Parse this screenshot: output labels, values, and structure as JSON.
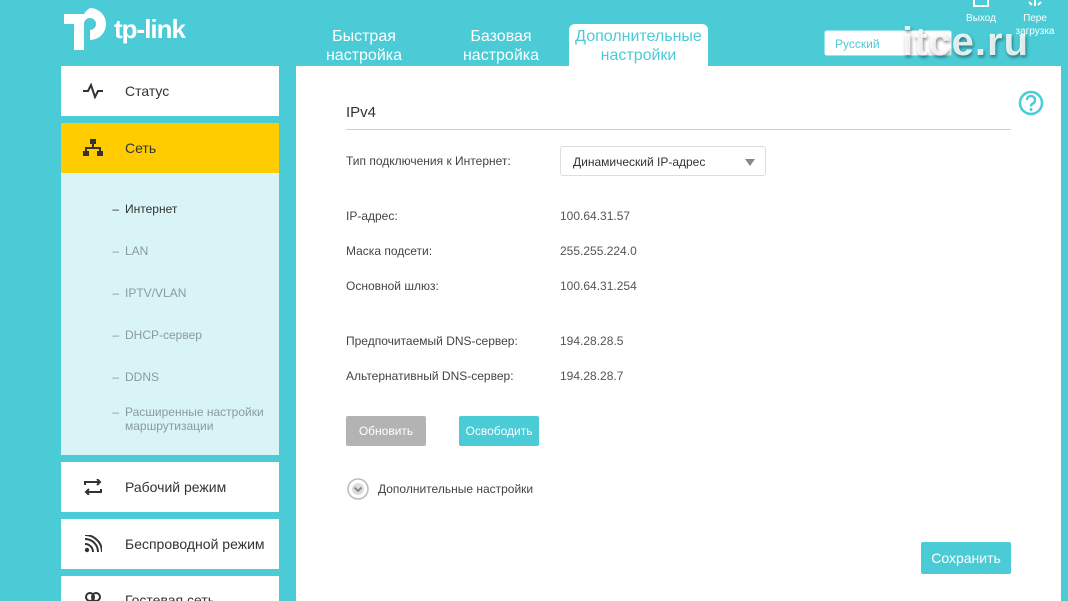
{
  "header": {
    "logo_text": "tp-link",
    "tabs": [
      {
        "label": "Быстрая настройка"
      },
      {
        "label": "Базовая настройка"
      },
      {
        "label": "Дополнительные настройки"
      }
    ],
    "language": "Русский",
    "logout_label": "Выход",
    "reboot_label": "Пере загрузка",
    "watermark": "itce.ru"
  },
  "sidebar": {
    "items": [
      {
        "label": "Статус",
        "icon": "pulse-icon"
      },
      {
        "label": "Сеть",
        "icon": "network-icon"
      },
      {
        "label": "Рабочий режим",
        "icon": "mode-switch-icon"
      },
      {
        "label": "Беспроводной режим",
        "icon": "wireless-icon"
      },
      {
        "label": "Гостевая сеть",
        "icon": "guest-network-icon"
      }
    ],
    "sub_items": [
      {
        "label": "Интернет"
      },
      {
        "label": "LAN"
      },
      {
        "label": "IPTV/VLAN"
      },
      {
        "label": "DHCP-сервер"
      },
      {
        "label": "DDNS"
      },
      {
        "label": "Расширенные настройки маршрутизации"
      }
    ]
  },
  "main": {
    "title": "IPv4",
    "connection_type_label": "Тип подключения к Интернет:",
    "connection_type_value": "Динамический IP-адрес",
    "fields": [
      {
        "label": "IP-адрес:",
        "value": "100.64.31.57"
      },
      {
        "label": "Маска подсети:",
        "value": "255.255.224.0"
      },
      {
        "label": "Основной шлюз:",
        "value": "100.64.31.254"
      },
      {
        "label": "Предпочитаемый DNS-сервер:",
        "value": "194.28.28.5"
      },
      {
        "label": "Альтернативный DNS-сервер:",
        "value": "194.28.28.7"
      }
    ],
    "renew_label": "Обновить",
    "release_label": "Освободить",
    "advanced_label": "Дополнительные настройки",
    "save_label": "Сохранить"
  },
  "colors": {
    "accent": "#4acbd6",
    "active_menu": "#ffcc00",
    "submenu_bg": "#d9f4f6"
  }
}
